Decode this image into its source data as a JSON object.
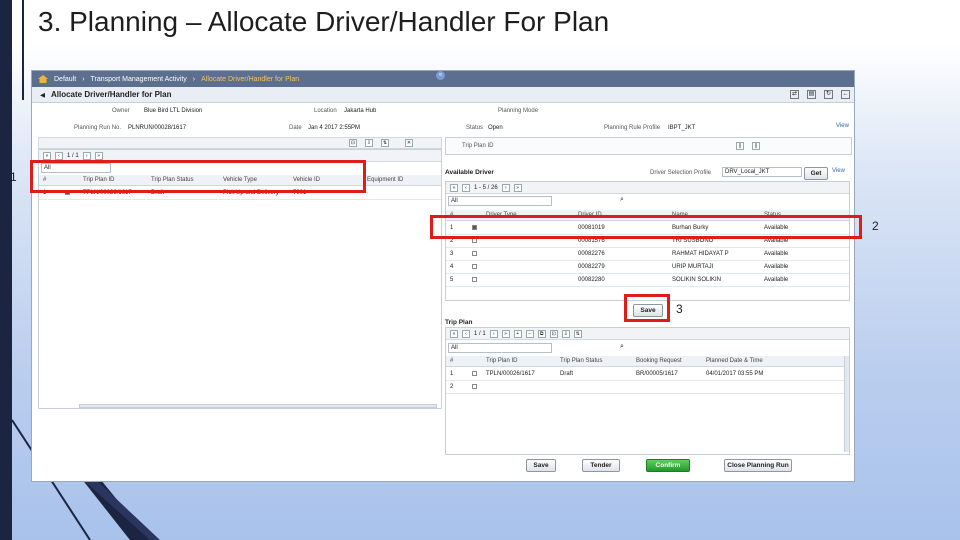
{
  "slide": {
    "title": "3. Planning – Allocate Driver/Handler For Plan",
    "callouts": [
      "1",
      "2",
      "3"
    ]
  },
  "breadcrumb": [
    "Default",
    "Transport Management Activity",
    "Allocate Driver/Handler for Plan"
  ],
  "window": {
    "title": "Allocate Driver/Handler for Plan",
    "toolbar_icons": [
      "shuffle-icon",
      "print-icon",
      "refresh-icon",
      "back-icon"
    ]
  },
  "form": {
    "owner_label": "Owner",
    "owner_value": "Blue Bird LTL Division",
    "location_label": "Location",
    "location_value": "Jakarta Hub",
    "planning_mode_label": "Planning Mode",
    "planning_run_label": "Planning Run No.",
    "planning_run_value": "PLNRUN/00028/1617",
    "date_label": "Date",
    "date_value": "Jan 4 2017 2:55PM",
    "status_label": "Status",
    "status_value": "Open",
    "rule_profile_label": "Planning Rule Profile",
    "rule_profile_value": "IBPT_JKT",
    "view_link": "View",
    "trip_plan_id_label": "Trip Plan ID"
  },
  "left_grid": {
    "pager": "1 / 1",
    "filter": "All",
    "headers": [
      "#",
      "",
      "Trip Plan ID",
      "Trip Plan Status",
      "Vehicle Type",
      "Vehicle ID",
      "Equipment ID"
    ],
    "rows": [
      {
        "no": "1",
        "trip_plan_id": "TPLN/00026/1617",
        "status": "Draft",
        "vehicle_type": "Pick Up and Delivery",
        "vehicle_id": "7001",
        "equipment_id": ""
      }
    ]
  },
  "available_driver": {
    "title": "Available Driver",
    "profile_label": "Driver Selection Profile",
    "profile_value": "DRV_Local_JKT",
    "get_button": "Get",
    "view_link": "View",
    "pager": "1 - 5 / 26",
    "filter": "All",
    "headers": [
      "#",
      "",
      "Driver Type",
      "Driver ID",
      "Name",
      "Status"
    ],
    "rows": [
      {
        "no": "1",
        "id": "00081019",
        "name": "Burhan Burky",
        "status": "Available"
      },
      {
        "no": "2",
        "id": "00081576",
        "name": "TRI SUSBONO",
        "status": "Available"
      },
      {
        "no": "3",
        "id": "00082276",
        "name": "RAHMAT HIDAYAT P",
        "status": "Available"
      },
      {
        "no": "4",
        "id": "00082279",
        "name": "URIP MURTAJI",
        "status": "Available"
      },
      {
        "no": "5",
        "id": "00082280",
        "name": "SOLIKIN SOLIKIN",
        "status": "Available"
      }
    ],
    "save_button": "Save"
  },
  "trip_plan": {
    "title": "Trip Plan",
    "pager": "1 / 1",
    "filter": "All",
    "headers": [
      "#",
      "",
      "Trip Plan ID",
      "Trip Plan Status",
      "Booking Request",
      "Planned Date & Time"
    ],
    "rows": [
      {
        "no": "1",
        "id": "TPLN/00026/1617",
        "status": "Draft",
        "booking": "BR/00005/1617",
        "planned": "04/01/2017 03:55 PM"
      },
      {
        "no": "2",
        "id": "",
        "status": "",
        "booking": "",
        "planned": ""
      }
    ]
  },
  "footer_buttons": [
    "Save",
    "Tender",
    "Confirm",
    "Close Planning Run"
  ],
  "colors": {
    "highlight": "#e01b1b",
    "breadcrumb_bg": "#5d6f8f",
    "confirm_green": "#22992d"
  }
}
